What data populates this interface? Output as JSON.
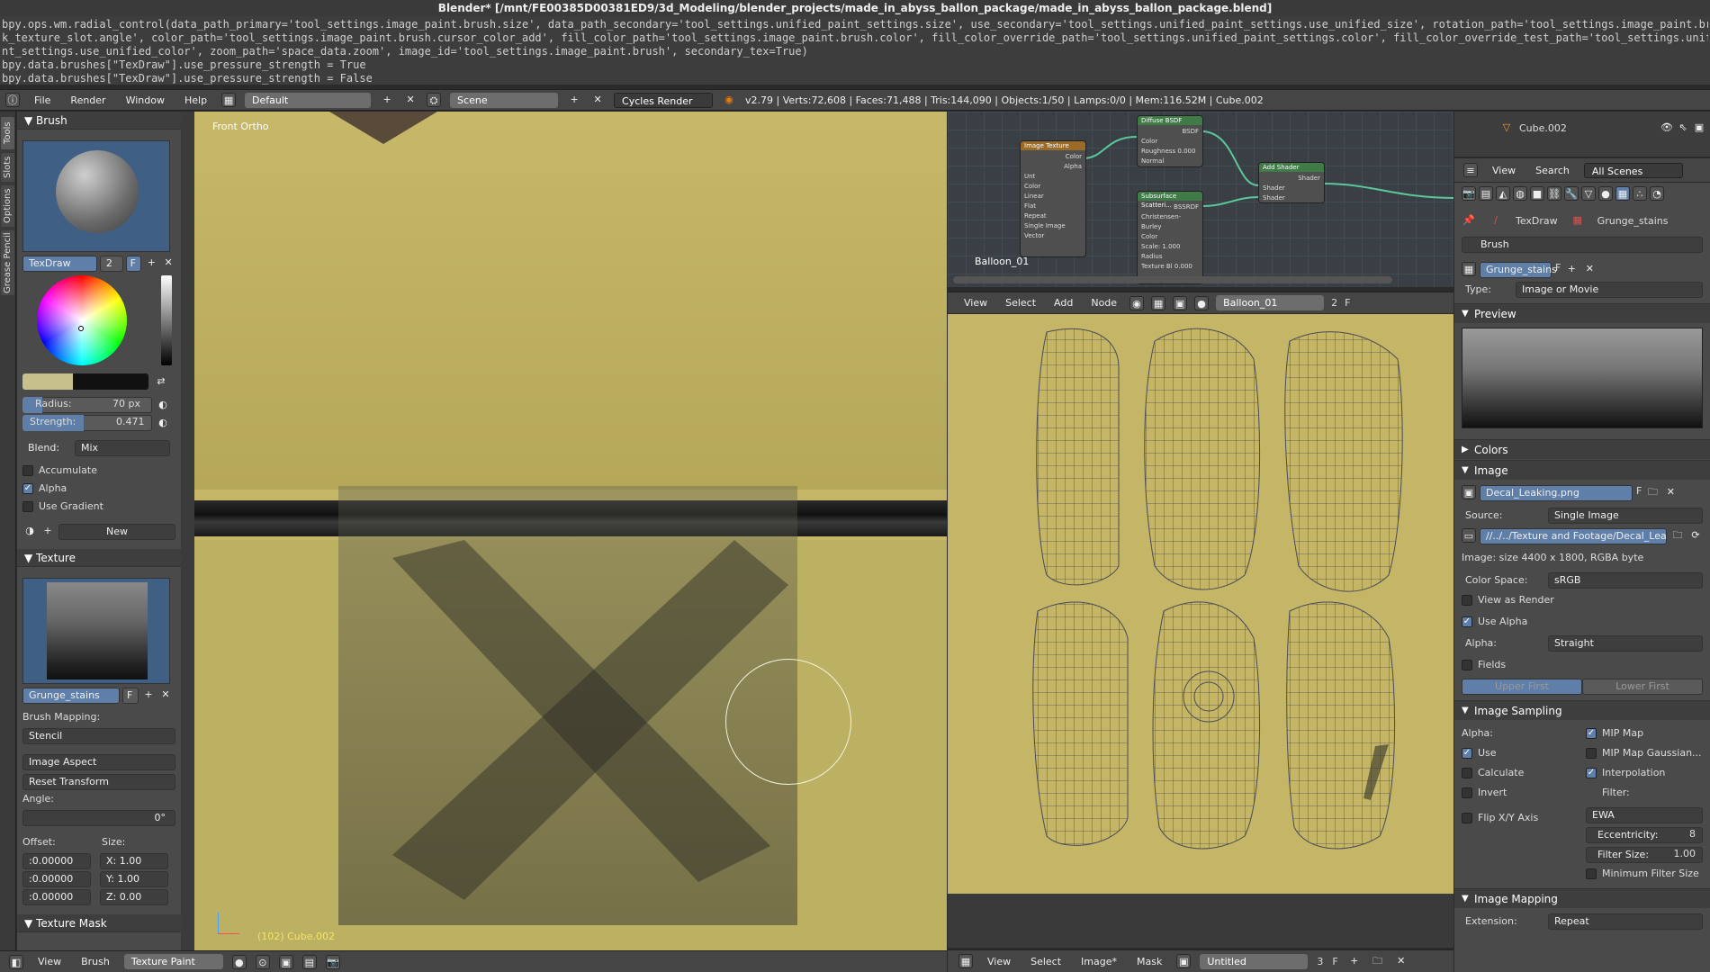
{
  "title": "Blender* [/mnt/FE00385D00381ED9/3d_Modeling/blender_projects/made_in_abyss_ballon_package/made_in_abyss_ballon_package.blend]",
  "console": [
    "bpy.ops.wm.radial_control(data_path_primary='tool_settings.image_paint.brush.size', data_path_secondary='tool_settings.unified_paint_settings.size', use_secondary='tool_settings.unified_paint_settings.use_unified_size', rotation_path='tool_settings.image_paint.brush.mas",
    "k_texture_slot.angle', color_path='tool_settings.image_paint.brush.cursor_color_add', fill_color_path='tool_settings.image_paint.brush.color', fill_color_override_path='tool_settings.unified_paint_settings.color', fill_color_override_test_path='tool_settings.unified_pai",
    "nt_settings.use_unified_color', zoom_path='space_data.zoom', image_id='tool_settings.image_paint.brush', secondary_tex=True)",
    "bpy.data.brushes[\"TexDraw\"].use_pressure_strength = True",
    "bpy.data.brushes[\"TexDraw\"].use_pressure_strength = False"
  ],
  "infobar": {
    "menus": [
      "File",
      "Render",
      "Window",
      "Help"
    ],
    "layout": "Default",
    "scene": "Scene",
    "engine": "Cycles Render",
    "stats": "v2.79 | Verts:72,608 | Faces:71,488 | Tris:144,090 | Objects:1/50 | Lamps:0/0 | Mem:116.52M | Cube.002"
  },
  "tabs": [
    "Tools",
    "Slots",
    "Options",
    "Grease Pencil"
  ],
  "toolshelf": {
    "brush_header": "Brush",
    "brush_name": "TexDraw",
    "brush_users": "2",
    "brush_f": "F",
    "radius_label": "Radius:",
    "radius_value": "70 px",
    "strength_label": "Strength:",
    "strength_value": "0.471",
    "blend_label": "Blend:",
    "blend_value": "Mix",
    "accumulate": "Accumulate",
    "alpha": "Alpha",
    "use_gradient": "Use Gradient",
    "new_label": "New",
    "texture_header": "Texture",
    "texture_name": "Grunge_stains",
    "texture_f": "F",
    "brush_mapping_label": "Brush Mapping:",
    "brush_mapping_value": "Stencil",
    "image_aspect": "Image Aspect",
    "reset_transform": "Reset Transform",
    "angle_label": "Angle:",
    "angle_value": "0°",
    "offset_label": "Offset:",
    "size_label": "Size:",
    "offsets": [
      ":0.00000",
      ":0.00000",
      ":0.00000"
    ],
    "sizes": [
      {
        "axis": "X:",
        "val": "1.00"
      },
      {
        "axis": "Y:",
        "val": "1.00"
      },
      {
        "axis": "Z:",
        "val": "0.00"
      }
    ],
    "texture_mask_header": "Texture Mask",
    "colors": {
      "strength_fill": "#5f7fa8",
      "swatch": "#c8c08c"
    }
  },
  "viewport": {
    "view_label": "Front Ortho",
    "object_label": "(102) Cube.002"
  },
  "bottombar": {
    "menus": [
      "View",
      "Brush"
    ],
    "mode": "Texture Paint"
  },
  "nodeeditor": {
    "material": "Balloon_01",
    "nodes": {
      "image_texture": {
        "title": "Image Texture",
        "rows": [
          "Color",
          "Alpha",
          "Unt",
          "Color",
          "Linear",
          "Flat",
          "Repeat",
          "Single Image",
          "Vector"
        ]
      },
      "diffuse": {
        "title": "Diffuse BSDF",
        "rows": [
          "BSDF",
          "Color",
          "Roughness 0.000",
          "Normal"
        ]
      },
      "sss": {
        "title": "Subsurface Scatteri...",
        "rows": [
          "BSSRDF",
          "Christensen-Burley",
          "Color",
          "Scale: 1.000",
          "Radius",
          "Texture Bl 0.000"
        ]
      },
      "add": {
        "title": "Add Shader",
        "rows": [
          "Shader",
          "Shader",
          "Shader"
        ]
      }
    },
    "bar_menus": [
      "View",
      "Select",
      "Add",
      "Node"
    ],
    "bar_material": "Balloon_01",
    "bar_users": "2",
    "bar_f": "F"
  },
  "uveditor": {
    "bar_menus": [
      "View",
      "Select",
      "Image*",
      "Mask"
    ],
    "image_name": "Untitled",
    "image_users": "3",
    "image_f": "F"
  },
  "outliner": {
    "item": "Cube.002"
  },
  "propsbar": {
    "menus": [
      "View",
      "Search"
    ],
    "filter": "All Scenes"
  },
  "props": {
    "crumb_brush": "TexDraw",
    "crumb_tex": "Grunge_stains",
    "brush_field": "Brush",
    "tex_name": "Grunge_stains",
    "tex_f": "F",
    "type_label": "Type:",
    "type_value": "Image or Movie",
    "preview_header": "Preview",
    "colors_header": "Colors",
    "image_header": "Image",
    "image_name": "Decal_Leaking.png",
    "image_f": "F",
    "source_label": "Source:",
    "source_value": "Single Image",
    "path": "//../../Texture and Footage/Decal_Leak...",
    "image_info": "Image: size 4400 x 1800, RGBA byte",
    "colorspace_label": "Color Space:",
    "colorspace_value": "sRGB",
    "view_as_render": "View as Render",
    "use_alpha": "Use Alpha",
    "alpha_label": "Alpha:",
    "alpha_value": "Straight",
    "fields": "Fields",
    "upper_first": "Upper First",
    "lower_first": "Lower First",
    "sampling_header": "Image Sampling",
    "s_alpha": "Alpha:",
    "s_use": "Use",
    "s_calculate": "Calculate",
    "s_invert": "Invert",
    "s_flip": "Flip X/Y Axis",
    "s_mipmap": "MIP Map",
    "s_mipgauss": "MIP Map Gaussian...",
    "s_interp": "Interpolation",
    "s_filter": "Filter:",
    "s_filter_value": "EWA",
    "s_ecc_label": "Eccentricity:",
    "s_ecc_val": "8",
    "s_fsize_label": "Filter Size:",
    "s_fsize_val": "1.00",
    "s_minfilter": "Minimum Filter Size",
    "mapping_header": "Image Mapping",
    "extension_label": "Extension:",
    "extension_value": "Repeat"
  }
}
